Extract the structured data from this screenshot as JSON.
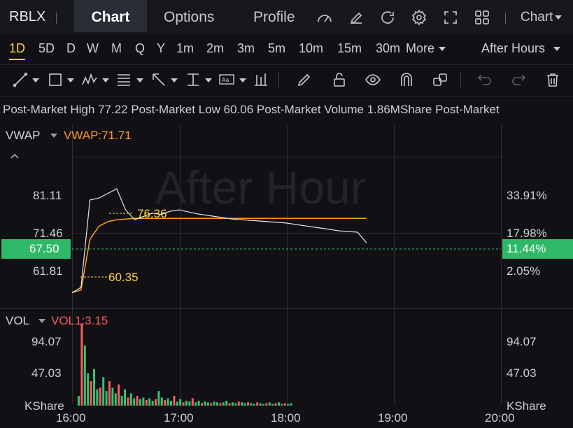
{
  "header": {
    "symbol": "RBLX",
    "tabs": [
      "Chart",
      "Options",
      "Profile"
    ],
    "active_tab": "Chart",
    "chart_menu_label": "Chart"
  },
  "timeframes": {
    "items": [
      "1D",
      "5D",
      "D",
      "W",
      "M",
      "Q",
      "Y",
      "1m",
      "2m",
      "3m",
      "5m",
      "10m",
      "15m",
      "30m"
    ],
    "more_label": "More",
    "active": "1D",
    "session_label": "After Hours"
  },
  "info_bar": {
    "high_label": "Post-Market High",
    "high_value": "77.22",
    "low_label": "Post-Market Low",
    "low_value": "60.06",
    "volume_label": "Post-Market Volume",
    "volume_value": "1.86MShare",
    "trailing": "Post-Market"
  },
  "price_panel": {
    "indicator": "VWAP",
    "indicator_value": "VWAP:71.71",
    "watermark": "After Hour",
    "left_ticks": [
      "81.11",
      "71.46",
      "61.81"
    ],
    "right_ticks": [
      "33.91%",
      "17.98%",
      "2.05%"
    ],
    "current_price": "67.50",
    "current_pct": "11.44%",
    "high_marker": "76.36",
    "low_marker": "60.35"
  },
  "volume_panel": {
    "indicator": "VOL",
    "indicator_value": "VOL1:3.15",
    "left_ticks": [
      "94.07",
      "47.03"
    ],
    "right_ticks": [
      "94.07",
      "47.03"
    ],
    "unit_left": "KShare",
    "unit_right": "KShare"
  },
  "time_axis": [
    "16:00",
    "17:00",
    "18:00",
    "19:00",
    "20:00"
  ],
  "colors": {
    "up": "#35c075",
    "down": "#ff5a5a",
    "vwap": "#ff9b2e",
    "marker": "#ffd33d",
    "background": "#111115"
  },
  "chart_data": {
    "type": "line",
    "x": [
      "16:00",
      "16:05",
      "16:10",
      "16:15",
      "16:20",
      "16:25",
      "16:30",
      "16:35",
      "16:40",
      "16:45",
      "16:50",
      "16:55",
      "17:00",
      "17:10",
      "17:20",
      "17:30",
      "17:40",
      "17:50",
      "18:00",
      "18:10",
      "18:20",
      "18:30",
      "18:40",
      "18:45"
    ],
    "series": [
      {
        "values": [
          60.4,
          61.2,
          74.5,
          74.8,
          75.5,
          76.2,
          73.0,
          71.5,
          72.0,
          72.5,
          72.3,
          72.8,
          73.0,
          72.4,
          72.0,
          71.6,
          71.4,
          71.2,
          71.0,
          70.6,
          70.2,
          69.8,
          69.6,
          68.0
        ]
      },
      {
        "values": [
          60.4,
          60.8,
          68.5,
          70.5,
          71.2,
          71.5,
          71.6,
          71.7,
          71.7,
          71.7,
          71.7,
          71.7,
          71.7,
          71.7,
          71.7,
          71.7,
          71.7,
          71.7,
          71.7,
          71.7,
          71.7,
          71.7,
          71.7,
          71.71
        ]
      }
    ],
    "ylim": [
      58,
      86
    ],
    "volume": [
      12,
      101,
      74,
      40,
      30,
      45,
      20,
      22,
      35,
      18,
      30,
      22,
      15,
      26,
      12,
      20,
      10,
      15,
      9,
      12,
      8,
      10,
      7,
      9,
      6,
      8,
      18,
      10,
      7,
      9,
      6,
      12,
      5,
      8,
      4,
      6,
      5,
      9,
      4,
      6,
      3,
      5,
      4,
      3,
      5,
      4,
      3,
      4,
      6,
      3,
      4,
      3,
      5,
      4,
      3,
      4,
      3,
      2,
      4,
      3,
      2,
      3,
      4,
      2,
      3,
      4,
      2,
      3,
      2,
      3
    ]
  }
}
